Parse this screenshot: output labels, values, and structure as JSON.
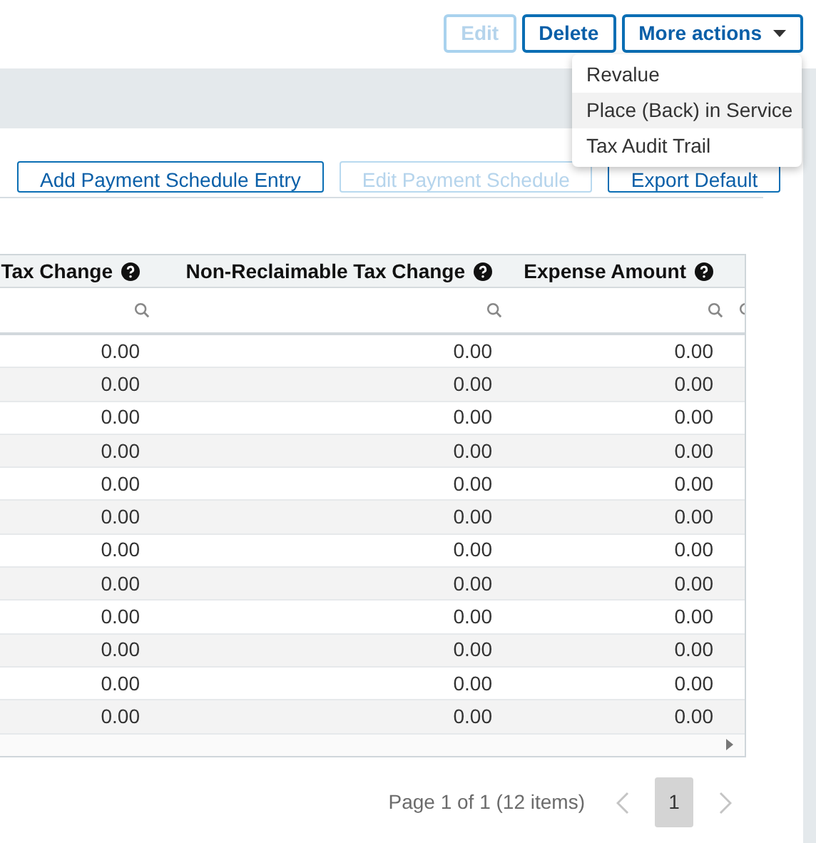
{
  "header_buttons": [
    {
      "label": "Edit",
      "disabled": true
    },
    {
      "label": "Delete",
      "disabled": false
    },
    {
      "label": "More actions",
      "disabled": false,
      "kind": "dropdown",
      "expanded": true
    }
  ],
  "menu": [
    {
      "label": "Revalue",
      "selected": false
    },
    {
      "label": "Place (Back) in Service",
      "selected": true
    },
    {
      "label": "Tax Audit Trail",
      "selected": false
    }
  ],
  "toolbar": [
    {
      "label": "Add Payment Schedule Entry",
      "disabled": false
    },
    {
      "label": "Edit Payment Schedule",
      "disabled": true
    },
    {
      "label": "Export Default",
      "disabled": false
    }
  ],
  "table": {
    "columns": [
      "Tax Change",
      "Non-Reclaimable Tax Change",
      "Expense Amount"
    ],
    "rows": [
      [
        "0.00",
        "0.00",
        "0.00"
      ],
      [
        "0.00",
        "0.00",
        "0.00"
      ],
      [
        "0.00",
        "0.00",
        "0.00"
      ],
      [
        "0.00",
        "0.00",
        "0.00"
      ],
      [
        "0.00",
        "0.00",
        "0.00"
      ],
      [
        "0.00",
        "0.00",
        "0.00"
      ],
      [
        "0.00",
        "0.00",
        "0.00"
      ],
      [
        "0.00",
        "0.00",
        "0.00"
      ],
      [
        "0.00",
        "0.00",
        "0.00"
      ],
      [
        "0.00",
        "0.00",
        "0.00"
      ],
      [
        "0.00",
        "0.00",
        "0.00"
      ],
      [
        "0.00",
        "0.00",
        "0.00"
      ]
    ]
  },
  "pager": {
    "summary": "Page 1 of 1 (12 items)",
    "pages": [
      {
        "label": "1",
        "selected": true
      }
    ]
  }
}
